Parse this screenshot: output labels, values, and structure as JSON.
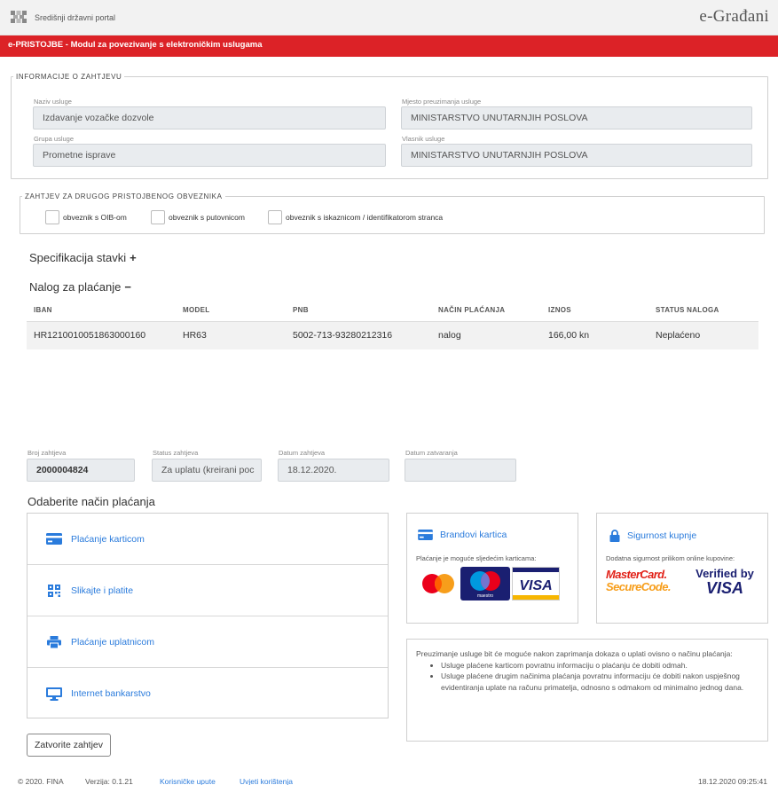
{
  "header": {
    "portal_label": "Središnji državni portal",
    "brand": "e-Građani"
  },
  "module_bar": {
    "title": "e-PRISTOJBE - Modul za povezivanje s elektroničkim uslugama"
  },
  "request_info": {
    "legend": "INFORMACIJE O ZAHTJEVU",
    "fields": [
      {
        "label": "Naziv usluge",
        "value": "Izdavanje vozačke dozvole"
      },
      {
        "label": "Mjesto preuzimanja usluge",
        "value": "MINISTARSTVO UNUTARNJIH POSLOVA"
      },
      {
        "label": "Grupa usluge",
        "value": "Prometne isprave"
      },
      {
        "label": "Vlasnik usluge",
        "value": "MINISTARSTVO UNUTARNJIH POSLOVA"
      }
    ]
  },
  "other_payer": {
    "legend": "ZAHTJEV ZA DRUGOG PRISTOJBENOG OBVEZNIKA",
    "options": [
      {
        "label": "obveznik s OIB-om",
        "checked": false
      },
      {
        "label": "obveznik s putovnicom",
        "checked": false
      },
      {
        "label": "obveznik s iskaznicom / identifikatorom stranca",
        "checked": false
      }
    ]
  },
  "items_spec": {
    "title": "Specifikacija stavki",
    "toggle": "+"
  },
  "payment_order": {
    "title": "Nalog za plaćanje",
    "toggle": "−",
    "columns": [
      "IBAN",
      "MODEL",
      "PNB",
      "NAČIN PLAĆANJA",
      "IZNOS",
      "STATUS NALOGA"
    ],
    "rows": [
      [
        "HR1210010051863000160",
        "HR63",
        "5002-713-93280212316",
        "nalog",
        "166,00 kn",
        "Neplaćeno"
      ]
    ]
  },
  "request_meta": {
    "fields": [
      {
        "label": "Broj zahtjeva",
        "value": "2000004824"
      },
      {
        "label": "Status zahtjeva",
        "value": "Za uplatu (kreirani poc"
      },
      {
        "label": "Datum zahtjeva",
        "value": "18.12.2020."
      },
      {
        "label": "Datum zatvaranja",
        "value": ""
      }
    ]
  },
  "payment_methods": {
    "title": "Odaberite način plaćanja",
    "items": [
      {
        "label": "Plaćanje karticom",
        "icon": "credit-card-icon"
      },
      {
        "label": "Slikajte i platite",
        "icon": "qr-code-icon"
      },
      {
        "label": "Plaćanje uplatnicom",
        "icon": "printer-icon"
      },
      {
        "label": "Internet bankarstvo",
        "icon": "monitor-icon"
      }
    ]
  },
  "card_brands": {
    "title": "Brandovi kartica",
    "subtitle": "Plaćanje je moguće sljedećim karticama:",
    "logos": {
      "maestro": "maestro",
      "visa": "VISA"
    }
  },
  "secure_purchase": {
    "title": "Sigurnost kupnje",
    "subtitle": "Dodatna sigurnost prilikom online kupovine:",
    "mastercard_line1": "MasterCard.",
    "mastercard_line2": "SecureCode.",
    "verified_line1": "Verified by",
    "verified_line2": "VISA"
  },
  "notice": {
    "intro": "Preuzimanje usluge bit će moguće nakon zaprimanja dokaza o uplati ovisno o načinu plaćanja:",
    "bullets": [
      "Usluge plaćene karticom povratnu informaciju o plaćanju će dobiti odmah.",
      "Usluge plaćene drugim načinima plaćanja povratnu informaciju će dobiti nakon uspješnog evidentiranja uplate na računu primatelja, odnosno s odmakom od minimalno jednog dana."
    ]
  },
  "close_button": "Zatvorite zahtjev",
  "footer": {
    "copyright": "© 2020. FINA",
    "version": "Verzija: 0.1.21",
    "manual_link": "Korisničke upute",
    "terms_link": "Uvjeti korištenja",
    "timestamp": "18.12.2020 09:25:41"
  },
  "colors": {
    "accent_red": "#dc2227",
    "link_blue": "#2a7bdc"
  }
}
